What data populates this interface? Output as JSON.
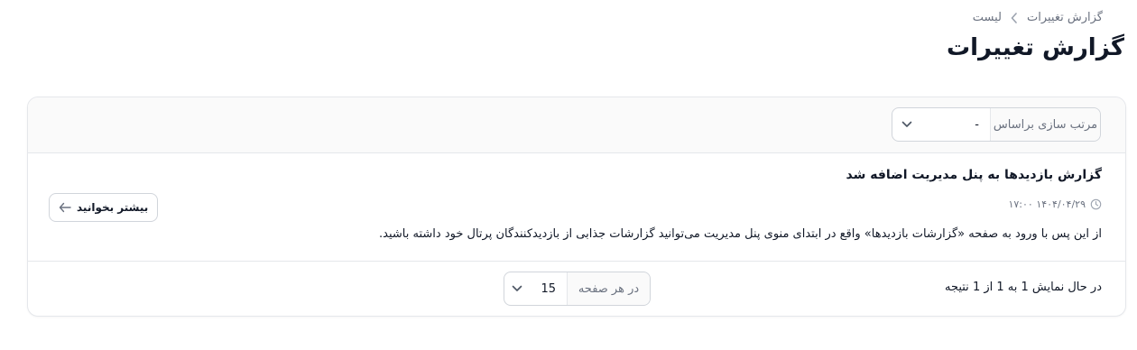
{
  "breadcrumb": {
    "parent": "گزارش تغییرات",
    "current": "لیست"
  },
  "page": {
    "title": "گزارش تغییرات"
  },
  "toolbar": {
    "sort_label": "مرتب سازی براساس",
    "sort_value": "-"
  },
  "entries": [
    {
      "title": "گزارش بازدیدها به پنل مدیریت اضافه شد",
      "datetime": "۱۴۰۴/۰۴/۲۹ ۱۷:۰۰",
      "description": "از این پس با ورود به صفحه «گزارشات بازدیدها» واقع در ابتدای منوی پنل مدیریت می‌توانید گزارشات جذابی از بازدیدکنندگان پرتال خود داشته باشید.",
      "read_more_label": "بیشتر بخوانید"
    }
  ],
  "pagination": {
    "results_text": "در حال نمایش 1 به 1 از 1 نتیجه",
    "per_page_label": "در هر صفحه",
    "per_page_value": "15"
  },
  "icons": {
    "breadcrumb_separator": "chevron-left-icon",
    "select_arrow": "chevron-down-icon",
    "time": "clock-icon",
    "read_more": "arrow-left-icon"
  },
  "colors": {
    "text_primary": "#111827",
    "text_muted": "#6b7280",
    "border": "#e5e7eb",
    "toolbar_bg": "#fafafa"
  }
}
